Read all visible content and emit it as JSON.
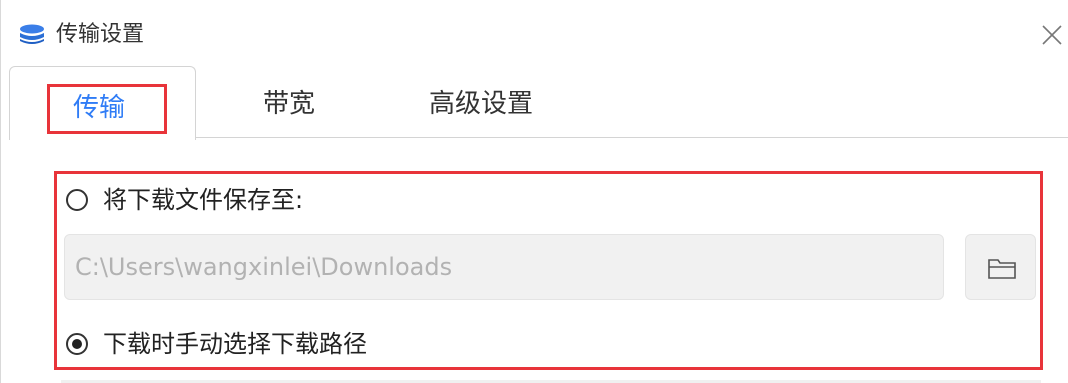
{
  "window": {
    "title": "传输设置",
    "icon": "app-logo-icon",
    "close_icon": "close-icon"
  },
  "tabs": [
    {
      "label": "传输",
      "active": true
    },
    {
      "label": "带宽",
      "active": false
    },
    {
      "label": "高级设置",
      "active": false
    }
  ],
  "download": {
    "save_to_label": "将下载文件保存至:",
    "save_to_selected": false,
    "path_value": "C:\\Users\\wangxinlei\\Downloads",
    "browse_icon": "folder-icon",
    "manual_label": "下载时手动选择下载路径",
    "manual_selected": true
  },
  "colors": {
    "accent": "#2f7cf6",
    "highlight": "#e8343a",
    "text": "#222222",
    "disabled_text": "#b2b2b2"
  }
}
